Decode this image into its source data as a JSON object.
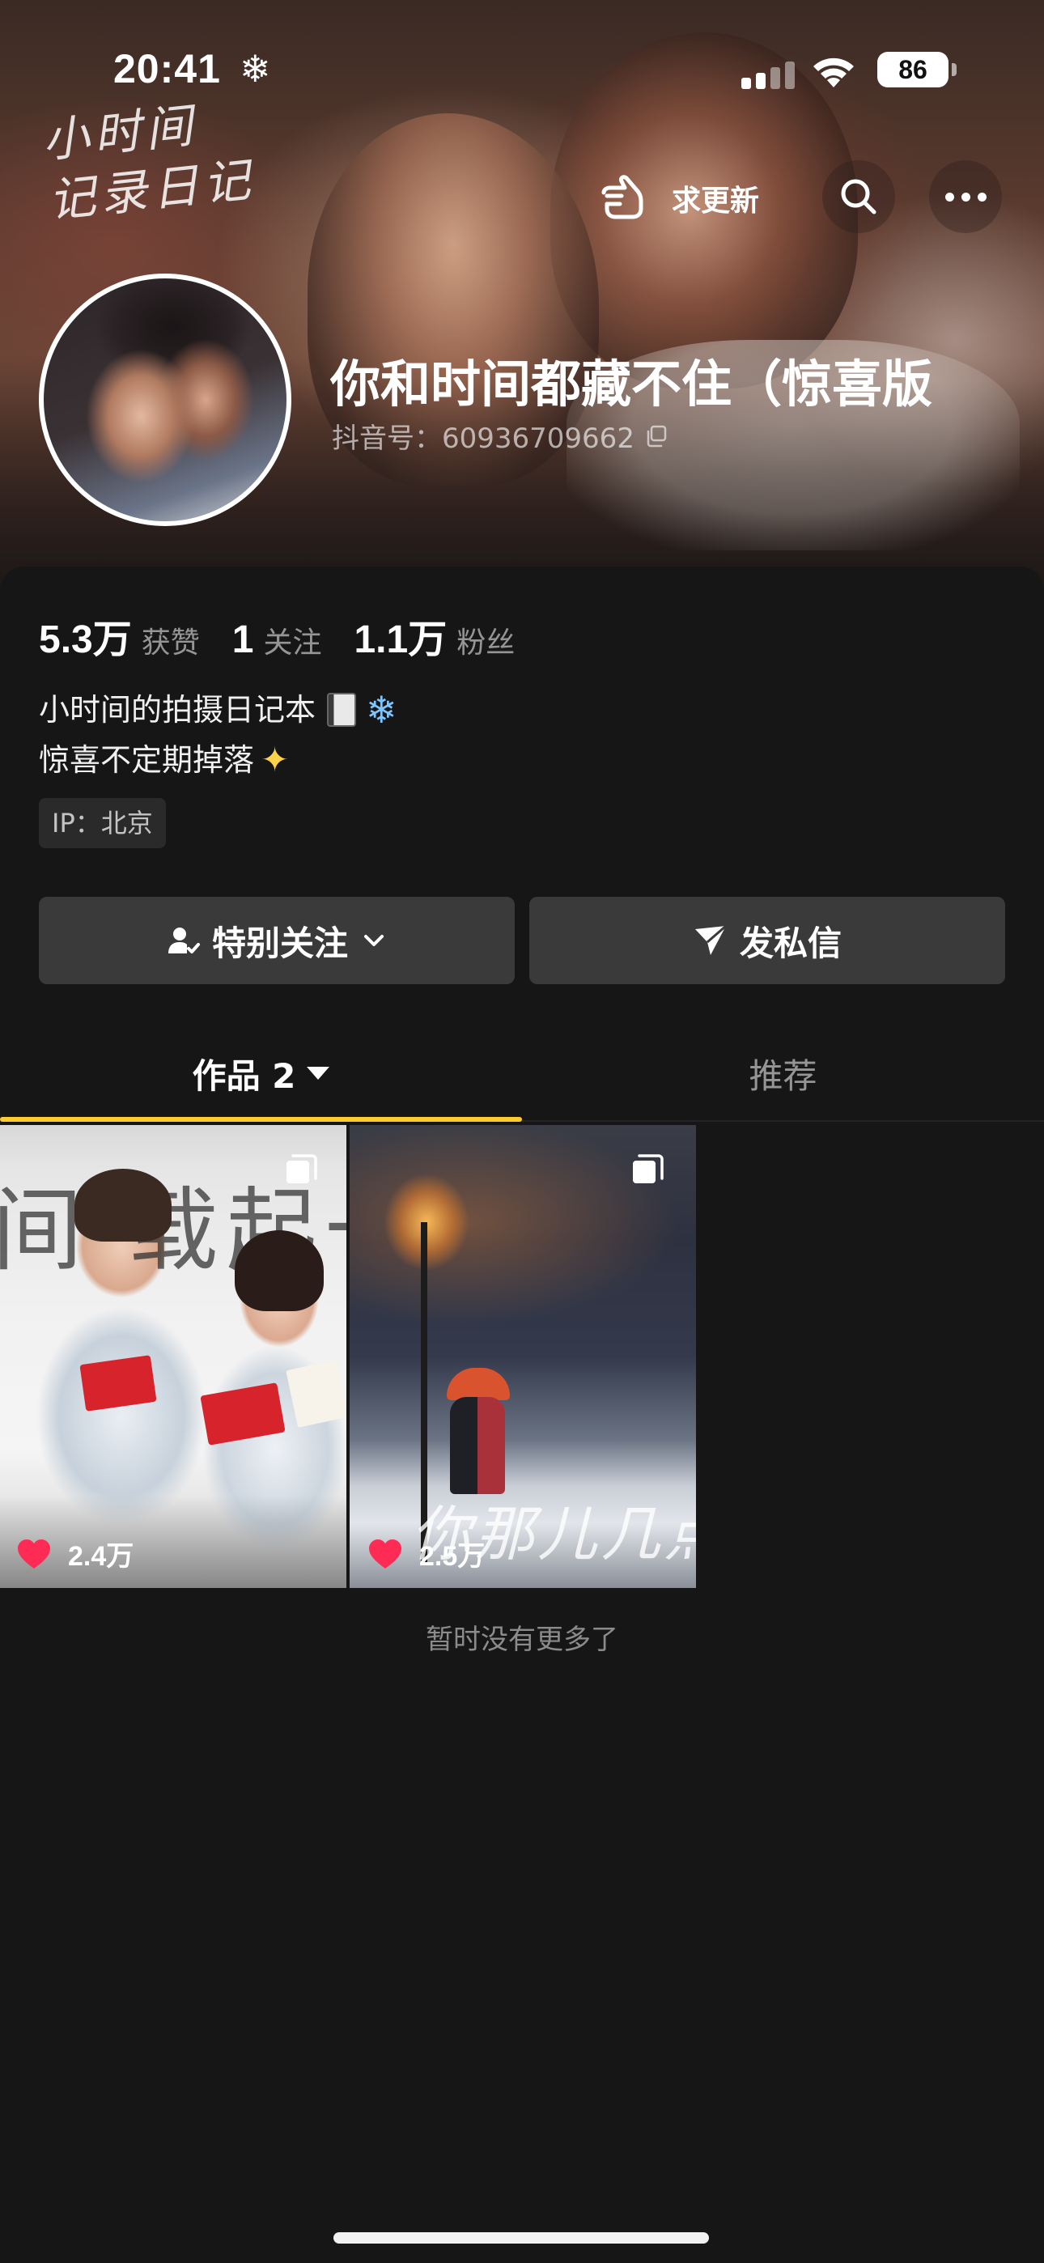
{
  "status_bar": {
    "time": "20:41",
    "weather_icon": "snowflake-icon",
    "signal_icon": "cellular-signal-icon",
    "wifi_icon": "wifi-icon",
    "battery": "86"
  },
  "banner": {
    "calligraphy_line1": "小时间",
    "calligraphy_line2": "记录日记",
    "update_button_label": "求更新",
    "update_icon": "pointing-hand-icon",
    "search_icon": "search-icon",
    "more_icon": "more-dots-icon"
  },
  "profile": {
    "name": "你和时间都藏不住（惊喜版",
    "douyin_id": "抖音号：60936709662",
    "copy_icon": "copy-icon"
  },
  "stats": [
    {
      "value": "5.3万",
      "label": "获赞"
    },
    {
      "value": "1",
      "label": "关注"
    },
    {
      "value": "1.1万",
      "label": "粉丝"
    }
  ],
  "bio": {
    "line1": "小时间的拍摄日记本",
    "line1_emoji": [
      "notebook-emoji",
      "snowflake-emoji"
    ],
    "line2": "惊喜不定期掉落",
    "line2_emoji": [
      "sparkles-emoji"
    ]
  },
  "ip_location": "IP：北京",
  "actions": {
    "follow_label": "特别关注",
    "message_label": "发私信"
  },
  "tabs": {
    "works_label": "作品 2",
    "recommend_label": "推荐",
    "active_tab": "works",
    "indicator_color": "#fccc2c"
  },
  "videos": [
    {
      "likes": "2.4万",
      "thumb_text": "间 载起一"
    },
    {
      "likes": "2.5万",
      "thumb_text": "你那儿几点"
    }
  ],
  "footer": {
    "no_more_text": "暂时没有更多了"
  },
  "colors": {
    "background": "#161616",
    "button_bg": "#3a3a3a",
    "like_heart": "#fe2c55"
  }
}
